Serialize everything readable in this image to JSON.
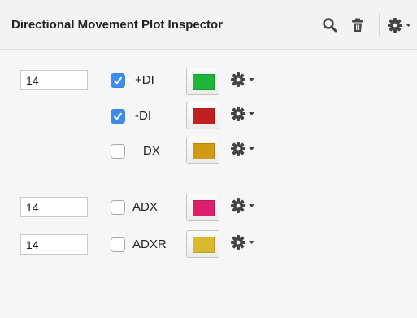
{
  "header": {
    "title": "Directional Movement Plot Inspector",
    "icons": [
      "search-icon",
      "trash-icon",
      "gear-menu-icon"
    ]
  },
  "rows": [
    {
      "input_value": "14",
      "checked": true,
      "label": "+DI",
      "color": "#1db53a"
    },
    {
      "checked": true,
      "label": "-DI",
      "color": "#c1201f"
    },
    {
      "checked": false,
      "label": "DX",
      "color": "#d19a12"
    },
    {
      "input_value": "14",
      "checked": false,
      "label": "ADX",
      "color": "#de1f6e"
    },
    {
      "input_value": "14",
      "checked": false,
      "label": "ADXR",
      "color": "#d9b92e"
    }
  ],
  "colors": {
    "checkbox_accent": "#3d8cf0",
    "icon": "#444444"
  }
}
